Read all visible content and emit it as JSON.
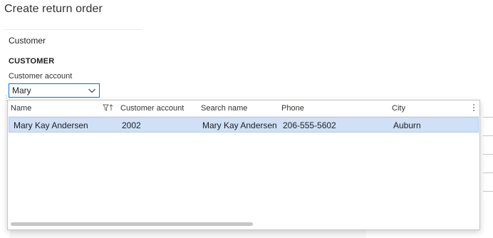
{
  "page": {
    "title": "Create return order"
  },
  "section": {
    "header": "Customer"
  },
  "group": {
    "title": "CUSTOMER",
    "field_label": "Customer account",
    "field_value": "Mary"
  },
  "lookup": {
    "columns": [
      "Name",
      "Customer account",
      "Search name",
      "Phone",
      "City"
    ],
    "rows": [
      {
        "name": "Mary Kay Andersen",
        "customer_account": "2002",
        "search_name": "Mary Kay Andersen",
        "phone": "206-555-5602",
        "city": "Auburn",
        "selected": true
      }
    ]
  },
  "icons": {
    "combo": "chevron-down-icon",
    "filter": "filter-sort-icon",
    "more": "more-vertical-icon"
  },
  "colors": {
    "accent": "#0078d4",
    "selected_row": "#cfe0f7"
  }
}
